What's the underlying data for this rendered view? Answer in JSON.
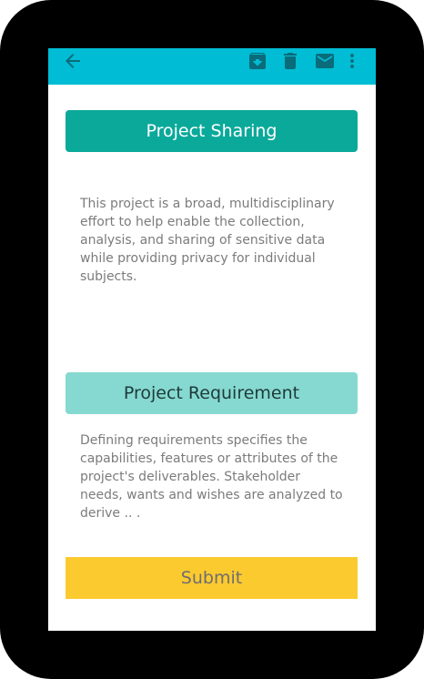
{
  "toolbar": {
    "background": "#00bcd4",
    "icons": [
      "arrow-back-icon",
      "archive-icon",
      "delete-icon",
      "mail-icon",
      "more-vert-icon"
    ]
  },
  "sections": {
    "sharing": {
      "title": "Project Sharing",
      "color": "#0aa99a",
      "description": "This project is a broad, multidisciplinary effort to help enable the collection, analysis, and sharing of sensitive data while providing privacy for individual subjects."
    },
    "requirement": {
      "title": "Project Requirement",
      "color": "#86d9d0",
      "description": "Defining requirements specifies the capabilities, features or attributes of the project's deliverables. Stakeholder needs, wants and wishes are analyzed to derive .. ."
    }
  },
  "submit": {
    "label": "Submit",
    "color": "#fbca2f"
  }
}
